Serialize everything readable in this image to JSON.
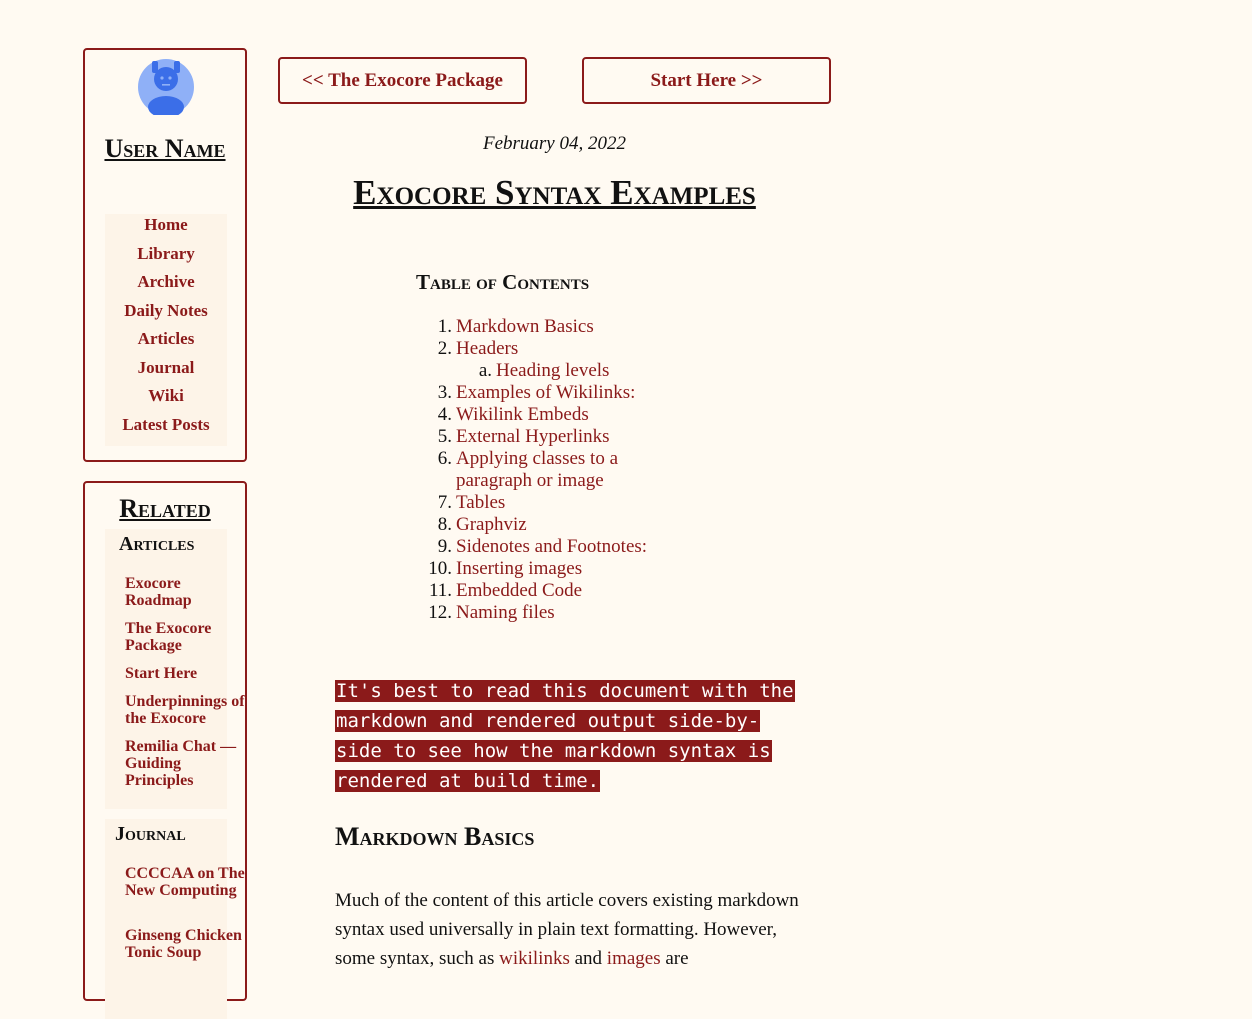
{
  "sidebar": {
    "username": "User Name",
    "nav": [
      "Home",
      "Library",
      "Archive",
      "Daily Notes",
      "Articles",
      "Journal",
      "Wiki",
      "Latest Posts"
    ],
    "related_title": "Related",
    "articles_heading": "Articles",
    "articles": [
      "Exocore Roadmap",
      "The Exocore Package",
      "Start Here",
      "Underpinnings of the Exocore",
      "Remilia Chat — Guiding Principles"
    ],
    "journal_heading": "Journal",
    "journal": [
      "CCCCAA on The New Computing",
      "Ginseng Chicken Tonic Soup"
    ]
  },
  "pager": {
    "prev": "<< The Exocore Package",
    "next": "Start Here >>"
  },
  "post": {
    "date": "February 04, 2022",
    "title": "Exocore Syntax Examples",
    "toc_title": "Table of Contents",
    "toc": [
      {
        "num": "1.",
        "label": "Markdown Basics"
      },
      {
        "num": "2.",
        "label": "Headers"
      },
      {
        "num": "a.",
        "label": "Heading levels"
      },
      {
        "num": "3.",
        "label": "Examples of Wikilinks:"
      },
      {
        "num": "4.",
        "label": "Wikilink Embeds"
      },
      {
        "num": "5.",
        "label": "External Hyperlinks"
      },
      {
        "num": "6.",
        "label": "Applying classes to a paragraph or image"
      },
      {
        "num": "7.",
        "label": "Tables"
      },
      {
        "num": "8.",
        "label": "Graphviz"
      },
      {
        "num": "9.",
        "label": "Sidenotes and Footnotes:"
      },
      {
        "num": "10.",
        "label": "Inserting images"
      },
      {
        "num": "11.",
        "label": "Embedded Code"
      },
      {
        "num": "12.",
        "label": "Naming files"
      }
    ],
    "note": "It's best to read this document with the markdown and rendered output side-by-side to see how the markdown syntax is rendered at build time.",
    "section_heading": "Markdown Basics",
    "para_before": "Much of the content of this article covers existing markdown syntax used universally in plain text formatting. However, some syntax, such as ",
    "link_wikilinks": "wikilinks",
    "para_and": " and ",
    "link_images": "images",
    "para_after": " are"
  },
  "colors": {
    "accent": "#8b1a1a",
    "background": "#fffaf2",
    "avatar": "#3b6ee8"
  }
}
